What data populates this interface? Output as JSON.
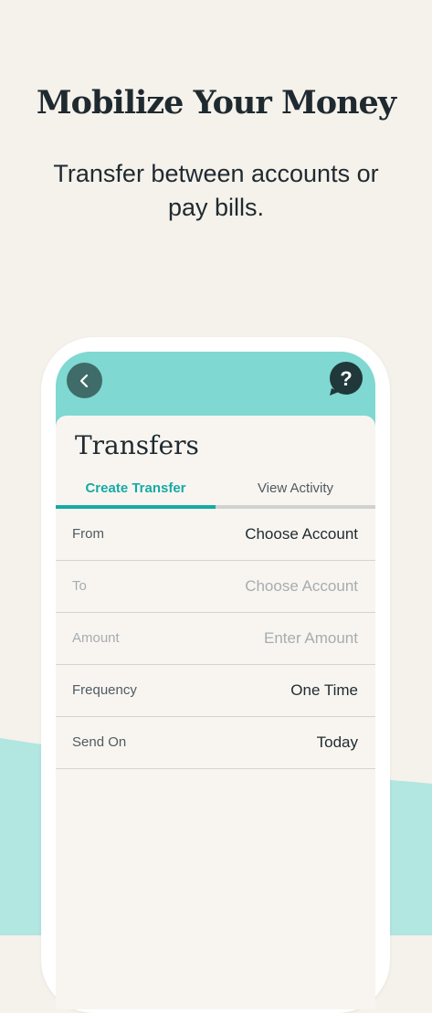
{
  "hero": {
    "headline": "Mobilize Your Money",
    "subhead": "Transfer between accounts or pay bills."
  },
  "colors": {
    "background": "#f5f1eb",
    "accent_teal": "#16aaa5",
    "header_teal": "#7fd8d1",
    "wave_teal": "#b1e6e1",
    "back_button": "#3f6b69",
    "help_button": "#20383a"
  },
  "app": {
    "back_icon": "chevron-left-icon",
    "help_icon": "question-bubble-icon",
    "help_glyph": "?",
    "title": "Transfers",
    "tabs": [
      {
        "label": "Create Transfer",
        "active": true
      },
      {
        "label": "View Activity",
        "active": false
      }
    ],
    "form": {
      "rows": [
        {
          "label": "From",
          "value": "Choose Account",
          "enabled": true
        },
        {
          "label": "To",
          "value": "Choose Account",
          "enabled": false
        },
        {
          "label": "Amount",
          "value": "Enter Amount",
          "enabled": false
        },
        {
          "label": "Frequency",
          "value": "One Time",
          "enabled": true
        },
        {
          "label": "Send On",
          "value": "Today",
          "enabled": true
        }
      ]
    }
  }
}
